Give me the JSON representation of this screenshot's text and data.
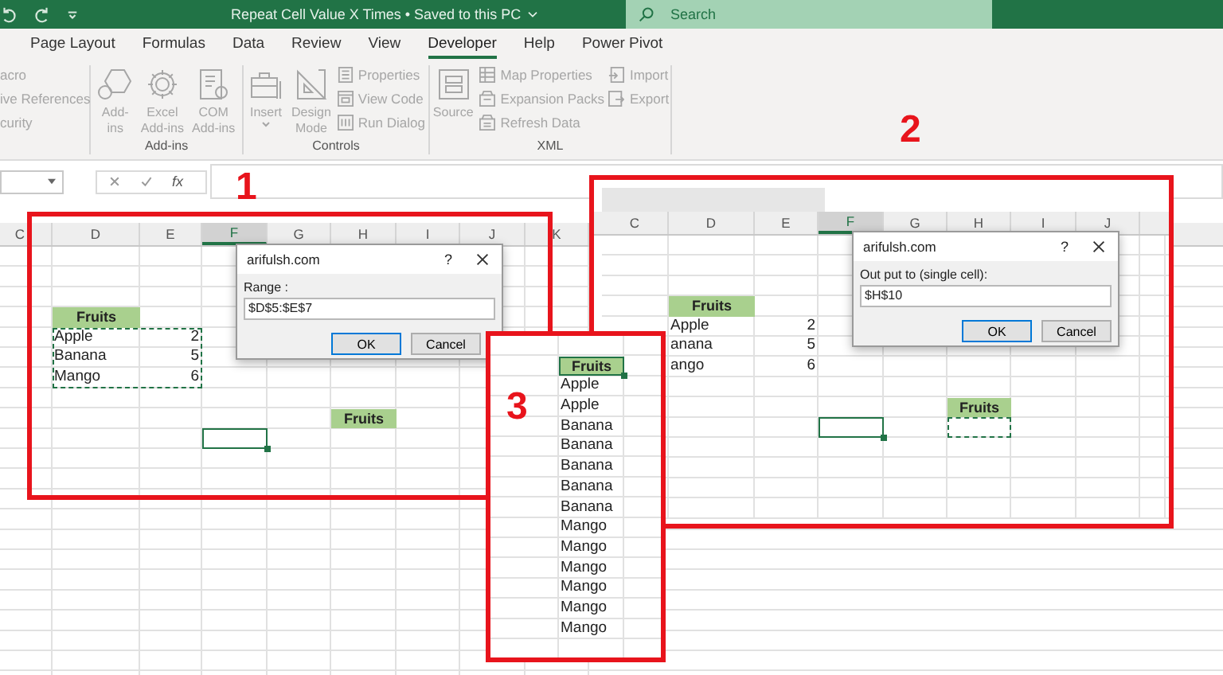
{
  "title_bar": {
    "title": "Repeat Cell Value X Times • Saved to this PC",
    "search": {
      "placeholder": "Search"
    }
  },
  "ribbon_tabs": [
    {
      "label": "Page Layout",
      "selected": false
    },
    {
      "label": "Formulas",
      "selected": false
    },
    {
      "label": "Data",
      "selected": false
    },
    {
      "label": "Review",
      "selected": false
    },
    {
      "label": "View",
      "selected": false
    },
    {
      "label": "Developer",
      "selected": true
    },
    {
      "label": "Help",
      "selected": false
    },
    {
      "label": "Power Pivot",
      "selected": false
    }
  ],
  "ribbon_groups": [
    {
      "commands": [
        {
          "kind": "small",
          "label": "acro"
        },
        {
          "kind": "small",
          "label": "ive References"
        },
        {
          "kind": "small",
          "label": "curity"
        }
      ]
    },
    {
      "label": "Add-ins",
      "commands": [
        {
          "kind": "large",
          "lines": [
            "Add-",
            "ins"
          ]
        },
        {
          "kind": "large",
          "lines": [
            "Excel",
            "Add-ins"
          ]
        },
        {
          "kind": "large",
          "lines": [
            "COM",
            "Add-ins"
          ]
        }
      ]
    },
    {
      "label": "Controls",
      "commands": [
        {
          "kind": "large",
          "lines": [
            "Insert"
          ]
        },
        {
          "kind": "large",
          "lines": [
            "Design",
            "Mode"
          ]
        },
        {
          "kind": "small",
          "label": "Properties"
        },
        {
          "kind": "small",
          "label": "View Code"
        },
        {
          "kind": "small",
          "label": "Run Dialog"
        }
      ]
    },
    {
      "label": "XML",
      "commands": [
        {
          "kind": "large",
          "lines": [
            "Source"
          ]
        },
        {
          "kind": "small",
          "label": "Map Properties"
        },
        {
          "kind": "small",
          "label": "Expansion Packs"
        },
        {
          "kind": "small",
          "label": "Refresh Data"
        },
        {
          "kind": "small",
          "label": "Import"
        },
        {
          "kind": "small",
          "label": "Export"
        }
      ]
    }
  ],
  "formula_bar": {
    "function_label": "fx"
  },
  "sheet": {
    "columns": [
      {
        "label": "C",
        "selected": false
      },
      {
        "label": "D",
        "selected": false
      },
      {
        "label": "E",
        "selected": false
      },
      {
        "label": "F",
        "selected": true
      },
      {
        "label": "G",
        "selected": false
      },
      {
        "label": "H",
        "selected": false
      },
      {
        "label": "I",
        "selected": false
      },
      {
        "label": "J",
        "selected": false
      },
      {
        "label": "K",
        "selected": false
      }
    ],
    "source_table": {
      "header": "Fruits",
      "rows": [
        {
          "name": "Apple",
          "count": "2"
        },
        {
          "name": "Banana",
          "count": "5"
        },
        {
          "name": "Mango",
          "count": "6"
        }
      ]
    },
    "output_header": "Fruits",
    "dialog": {
      "title": "arifulsh.com",
      "help": "?",
      "prompt": "Range :",
      "value": "$D$5:$E$7",
      "buttons": [
        {
          "label": "OK",
          "default": true
        },
        {
          "label": "Cancel",
          "default": false
        }
      ]
    }
  },
  "output_panel": {
    "columns": [
      {
        "label": "C",
        "selected": false
      },
      {
        "label": "D",
        "selected": false
      },
      {
        "label": "E",
        "selected": false
      },
      {
        "label": "F",
        "selected": true
      },
      {
        "label": "G",
        "selected": false
      },
      {
        "label": "H",
        "selected": false
      },
      {
        "label": "I",
        "selected": false
      },
      {
        "label": "J",
        "selected": false
      }
    ],
    "source_table": {
      "header": "Fruits",
      "rows": [
        {
          "name": "Apple",
          "count": "2"
        },
        {
          "name": "anana",
          "count": "5"
        },
        {
          "name": "ango",
          "count": "6"
        }
      ]
    },
    "output_header": "Fruits",
    "dialog": {
      "title": "arifulsh.com",
      "help": "?",
      "prompt": "Out put to (single cell):",
      "value": "$H$10",
      "buttons": [
        {
          "label": "OK",
          "default": true
        },
        {
          "label": "Cancel",
          "default": false
        }
      ]
    }
  },
  "result_panel": {
    "header": "Fruits",
    "values": [
      "Apple",
      "Apple",
      "Banana",
      "Banana",
      "Banana",
      "Banana",
      "Banana",
      "Mango",
      "Mango",
      "Mango",
      "Mango",
      "Mango",
      "Mango"
    ]
  },
  "annotations": [
    "1",
    "2",
    "3"
  ]
}
